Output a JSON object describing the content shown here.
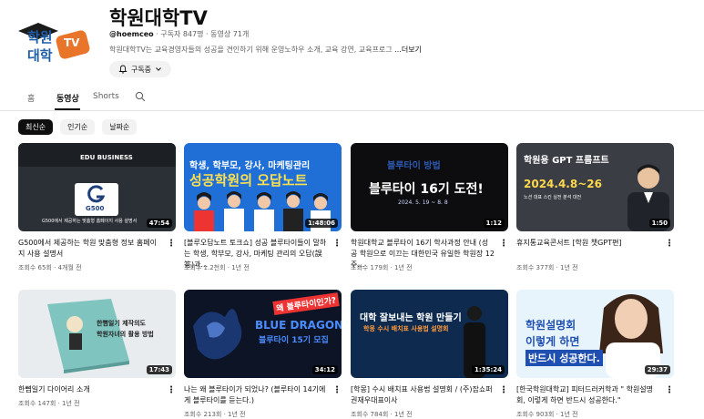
{
  "channel": {
    "name": "학원대학TV",
    "handle": "@hoemceo",
    "stats": "· 구독자 847명 · 동영상 71개",
    "description": "학원대학TV는 교육경영자들의 성공을 견인하기 위해 운영노하우 소개, 교육 강연, 교육프로그",
    "more_label": "...더보기",
    "subscribe_label": "구독중",
    "logo_text_top": "학원",
    "logo_text_bottom": "대학",
    "logo_badge": "TV"
  },
  "tabs": [
    {
      "label": "홈"
    },
    {
      "label": "동영상"
    },
    {
      "label": "Shorts"
    }
  ],
  "chips": [
    {
      "label": "최신순"
    },
    {
      "label": "인기순"
    },
    {
      "label": "날짜순"
    }
  ],
  "videos": [
    {
      "title": "G500에서 제공하는 학원 맞춤형 정보 홈페이지 사용 설명서",
      "meta": "조회수 65회 · 4개월 전",
      "duration": "47:54",
      "thumb": {
        "l1": "EDU BUSINESS",
        "l2": "G500",
        "l3": "G500에서 제공하는 맞춤형 홈페이지 사용 설명서"
      }
    },
    {
      "title": "[블루오답노트 토크쇼] 성공 블루타이들이 말하는 학생, 학부모, 강사, 마케팅 관리의 오답(誤答)과...",
      "meta": "조회수 1.2천회 · 1년 전",
      "duration": "1:48:06",
      "thumb": {
        "l1": "학생, 학부모, 강사, 마케팅관리",
        "l2": "성공학원의 오답노트"
      }
    },
    {
      "title": "학원대학교 블루타이 16기 학사과정 안내 (성공 학원으로 이끄는 대한민국 유일한 학원장 12주...",
      "meta": "조회수 179회 · 1년 전",
      "duration": "1:12",
      "thumb": {
        "l1": "블루타이 방법",
        "l2": "블루타이 16기 도전!",
        "l3": "2024. 5. 19 ~ 8. 8"
      }
    },
    {
      "title": "휴지통교육콘서트 [학원 챗GPT편]",
      "meta": "조회수 377회 · 1년 전",
      "duration": "1:50",
      "thumb": {
        "l1": "학원용 GPT 프롬프트",
        "l2": "2024.4.8~26",
        "l3": "노션 대표 스킨 실전 분석 대전"
      }
    },
    {
      "title": "한뼘일기 다이어리 소개",
      "meta": "조회수 147회 · 1년 전",
      "duration": "17:43",
      "thumb": {
        "l1": "한뼘일기 제작의도",
        "l2": "학원자녀의 활용 방법"
      }
    },
    {
      "title": "나는 왜 블루타이가 되었나? (블루타이 14기에게 블루타이를 듣는다.)",
      "meta": "조회수 213회 · 1년 전",
      "duration": "34:12",
      "thumb": {
        "l1": "왜 블루타이인가?",
        "l2": "BLUE DRAGON",
        "l3": "블루타이 15기 모집"
      }
    },
    {
      "title": "[학몽] 수시 배치표 사용법 설명회 / (주)잡쇼퍼 권재우대표이사",
      "meta": "조회수 784회 · 1년 전",
      "duration": "1:35:24",
      "thumb": {
        "l1": "대학 잘보내는 학원 만들기",
        "l2": "학몽 수시 배치표 사용법 설명회"
      }
    },
    {
      "title": "[한국학원대학교] 피터드러커학과 \" 학원설명회, 이렇게 하면 반드시 성공한다.\"",
      "meta": "조회수 903회 · 1년 전",
      "duration": "29:37",
      "thumb": {
        "l1": "학원설명회",
        "l2": "이렇게 하면",
        "l3": "반드시 성공한다."
      }
    }
  ],
  "colors": {
    "accent_orange": "#e8752a",
    "logo_blue": "#1f5ea8",
    "dark": "#0f0f0f",
    "gray": "#606060"
  }
}
